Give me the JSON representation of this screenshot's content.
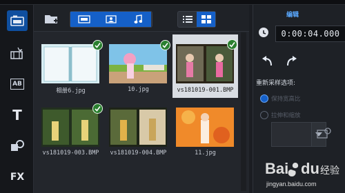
{
  "library": {
    "thumbnails": [
      {
        "caption": "相册6.jpg",
        "checked": true,
        "selected": false
      },
      {
        "caption": "10.jpg",
        "checked": true,
        "selected": false
      },
      {
        "caption": "vs181019-001.BMP",
        "checked": true,
        "selected": true
      },
      {
        "caption": "vs181019-003.BMP",
        "checked": true,
        "selected": false
      },
      {
        "caption": "vs181019-004.BMP",
        "checked": false,
        "selected": false
      },
      {
        "caption": "11.jpg",
        "checked": false,
        "selected": false
      }
    ]
  },
  "rail": {
    "text_label": "T",
    "fx_label": "FX",
    "title_label": "AB"
  },
  "right_panel": {
    "tab_label": "编辑",
    "timecode": "0:00:04.000",
    "resample_label": "重新采样选项:",
    "option1": "保持宽高比",
    "option2": "拉伸和缩放"
  },
  "watermark": {
    "brand": "Bai du 经验",
    "url": "jingyan.baidu.com"
  },
  "colors": {
    "accent": "#1560c8",
    "check": "#2a7f2f",
    "selected_bg": "#d9dde3"
  }
}
